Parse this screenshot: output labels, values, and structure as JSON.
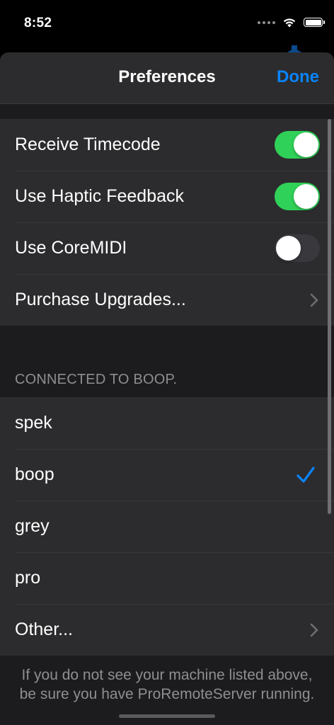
{
  "status_bar": {
    "time": "8:52"
  },
  "nav": {
    "title": "Preferences",
    "done_label": "Done"
  },
  "settings": {
    "receive_timecode": {
      "label": "Receive Timecode",
      "on": true
    },
    "haptic_feedback": {
      "label": "Use Haptic Feedback",
      "on": true
    },
    "core_midi": {
      "label": "Use CoreMIDI",
      "on": false
    },
    "purchase_upgrades": {
      "label": "Purchase Upgrades..."
    }
  },
  "machines": {
    "header": "CONNECTED TO BOOP.",
    "items": [
      {
        "label": "spek",
        "selected": false
      },
      {
        "label": "boop",
        "selected": true
      },
      {
        "label": "grey",
        "selected": false
      },
      {
        "label": "pro",
        "selected": false
      }
    ],
    "other_label": "Other..."
  },
  "footer": {
    "text": "If you do not see your machine listed above, be sure you have ProRemoteServer running."
  },
  "colors": {
    "accent": "#0a84ff",
    "toggle_on": "#30d158",
    "toggle_off": "#39393d",
    "background": "#1c1c1e",
    "cell": "#2c2c2e"
  }
}
